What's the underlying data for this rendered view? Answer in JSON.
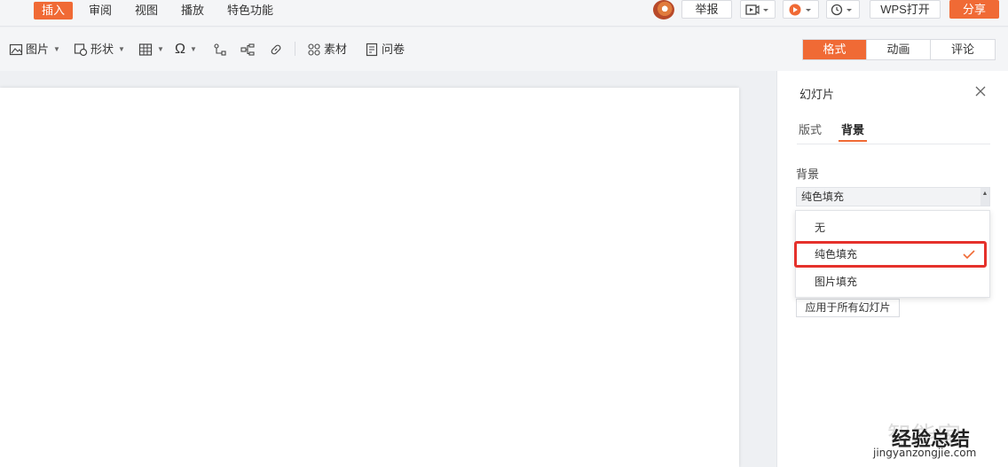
{
  "topbar": {
    "menu": [
      "插入",
      "审阅",
      "视图",
      "播放",
      "特色功能"
    ],
    "active_menu": "插入",
    "report": "举报",
    "wps_open": "WPS打开",
    "share": "分享"
  },
  "toolbar": {
    "picture": "图片",
    "shape": "形状",
    "material": "素材",
    "survey": "问卷",
    "tabs": [
      "格式",
      "动画",
      "评论"
    ],
    "active_tab": "格式"
  },
  "panel": {
    "title": "幻灯片",
    "tabs": [
      "版式",
      "背景"
    ],
    "active_tab": "背景",
    "background_label": "背景",
    "select_value": "纯色填充",
    "options": [
      "无",
      "纯色填充",
      "图片填充"
    ],
    "selected_option": "纯色填充",
    "apply_all": "应用于所有幻灯片"
  },
  "watermark": {
    "faded": "智能家",
    "main": "经验总结",
    "url": "jingyanzongjie.com"
  },
  "colors": {
    "accent": "#f06a35",
    "highlight": "#e5312b"
  }
}
